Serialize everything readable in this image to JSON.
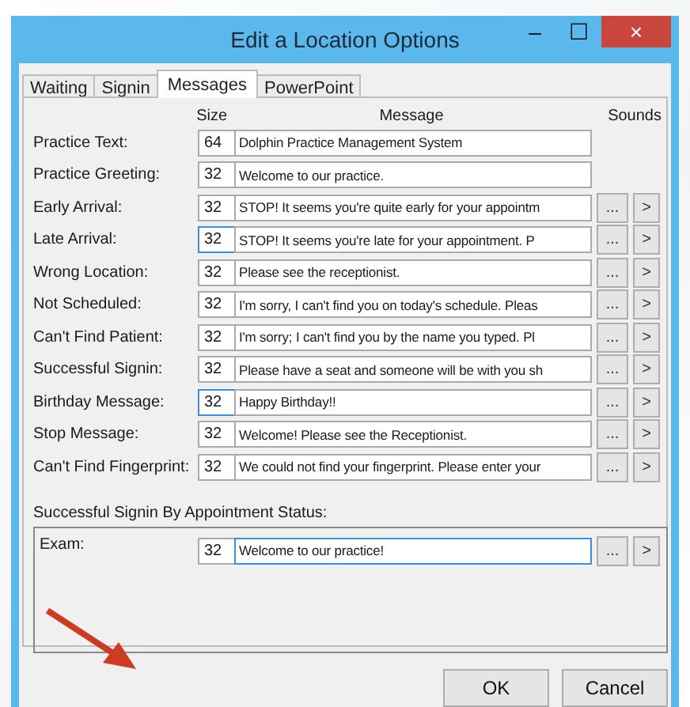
{
  "window": {
    "title": "Edit a Location Options",
    "controls": [
      "–",
      "☐",
      "×"
    ]
  },
  "tabs": [
    {
      "label": "Waiting",
      "selected": false
    },
    {
      "label": "Signin",
      "selected": false
    },
    {
      "label": "Messages",
      "selected": true
    },
    {
      "label": "PowerPoint",
      "selected": false
    }
  ],
  "columns": [
    "Size",
    "Message",
    "Sounds"
  ],
  "rows": [
    {
      "kind": "text",
      "label": "Practice Text:",
      "size": "64",
      "message": "Dolphin Practice Management System",
      "size_focused": false,
      "message_focused": false
    },
    {
      "kind": "text",
      "label": "Practice Greeting:",
      "size": "32",
      "message": "Welcome to our practice.",
      "size_focused": false,
      "message_focused": false
    },
    {
      "kind": "sound",
      "label": "Early Arrival:",
      "size": "32",
      "message": "STOP!  It seems you're quite early for your appointm",
      "size_focused": false,
      "message_focused": false,
      "browse": "...",
      "play": ">"
    },
    {
      "kind": "sound",
      "label": "Late Arrival:",
      "size": "32",
      "message": "STOP!  It seems you're late for your appointment.  P",
      "size_focused": true,
      "message_focused": false,
      "browse": "...",
      "play": ">"
    },
    {
      "kind": "sound",
      "label": "Wrong Location:",
      "size": "32",
      "message": "Please see the receptionist.",
      "size_focused": false,
      "message_focused": false,
      "browse": "...",
      "play": ">"
    },
    {
      "kind": "sound",
      "label": "Not Scheduled:",
      "size": "32",
      "message": "I'm sorry, I can't find you on today's schedule.  Pleas",
      "size_focused": false,
      "message_focused": false,
      "browse": "...",
      "play": ">"
    },
    {
      "kind": "sound",
      "label": "Can't Find Patient:",
      "size": "32",
      "message": "I'm sorry; I can't find you by the name you typed.  Pl",
      "size_focused": false,
      "message_focused": false,
      "browse": "...",
      "play": ">"
    },
    {
      "kind": "sound",
      "label": "Successful Signin:",
      "size": "32",
      "message": "Please have a seat and someone will be with you sh",
      "size_focused": false,
      "message_focused": false,
      "browse": "...",
      "play": ">"
    },
    {
      "kind": "sound",
      "label": "Birthday Message:",
      "size": "32",
      "message": "Happy Birthday!!",
      "size_focused": true,
      "message_focused": false,
      "browse": "...",
      "play": ">"
    },
    {
      "kind": "sound",
      "label": "Stop Message:",
      "size": "32",
      "message": "Welcome!  Please see the Receptionist.",
      "size_focused": false,
      "message_focused": false,
      "browse": "...",
      "play": ">"
    },
    {
      "kind": "sound",
      "label": "Can't Find Fingerprint:",
      "size": "32",
      "message": "We could not find your fingerprint. Please enter your",
      "size_focused": false,
      "message_focused": false,
      "browse": "...",
      "play": ">"
    }
  ],
  "status_group": {
    "title": "Successful Signin By Appointment Status:",
    "rows": [
      {
        "kind": "sound",
        "label": "Exam:",
        "size": "32",
        "message": "Welcome to our practice!",
        "size_focused": false,
        "message_focused": true,
        "browse": "...",
        "play": ">"
      }
    ]
  },
  "buttons": [
    "OK",
    "Cancel"
  ]
}
